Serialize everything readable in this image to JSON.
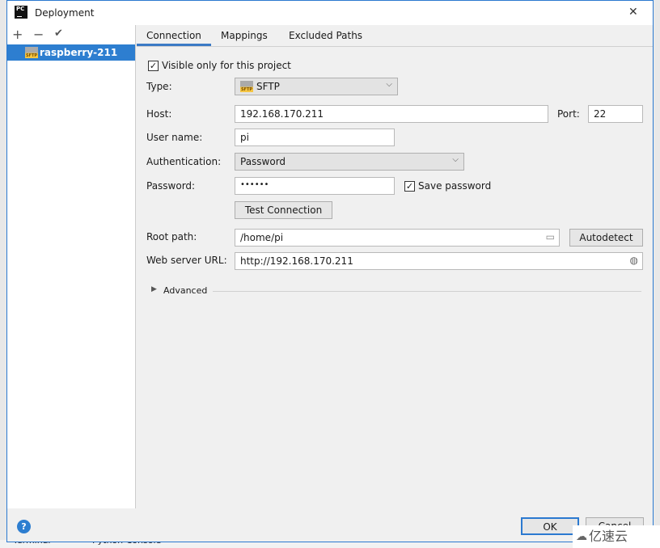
{
  "dialog": {
    "title": "Deployment",
    "close": "✕"
  },
  "sidebar": {
    "add": "+",
    "remove": "−",
    "apply": "✔",
    "servers": [
      {
        "name": "raspberry-211",
        "icon_text": "SFTP"
      }
    ]
  },
  "tabs": [
    {
      "label": "Connection",
      "active": true
    },
    {
      "label": "Mappings"
    },
    {
      "label": "Excluded Paths"
    }
  ],
  "form": {
    "visible_only": {
      "label": "Visible only for this project",
      "checked": true
    },
    "type": {
      "label": "Type:",
      "value": "SFTP"
    },
    "host": {
      "label": "Host:",
      "value": "192.168.170.211"
    },
    "port": {
      "label": "Port:",
      "value": "22"
    },
    "username": {
      "label": "User name:",
      "value": "pi"
    },
    "auth": {
      "label": "Authentication:",
      "value": "Password"
    },
    "password": {
      "label": "Password:",
      "value": "••••••"
    },
    "save_password": {
      "label": "Save password",
      "checked": true
    },
    "test_connection": "Test Connection",
    "root_path": {
      "label": "Root path:",
      "value": "/home/pi"
    },
    "autodetect": "Autodetect",
    "web_url": {
      "label": "Web server URL:",
      "value": "http://192.168.170.211"
    },
    "advanced": "Advanced"
  },
  "footer": {
    "help": "?",
    "ok": "OK",
    "cancel": "Cancel"
  },
  "background": {
    "terminal": "Terminal",
    "python_console": "Python Console",
    "watermark": "亿速云"
  },
  "colors": {
    "accent": "#2d7ed0",
    "selection": "#2d7ed0"
  }
}
